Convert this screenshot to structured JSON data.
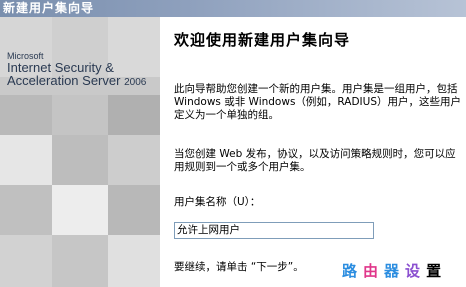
{
  "window": {
    "title": "新建用户集向导"
  },
  "banner": {
    "microsoft": "Microsoft",
    "line1": "Internet Security &",
    "line2": "Acceleration Server",
    "version": "2006"
  },
  "main": {
    "heading": "欢迎使用新建用户集向导",
    "intro": "此向导帮助您创建一个新的用户集。用户集是一组用户，包括 Windows 或非 Windows（例如，RADIUS）用户，这些用户定义为一个单独的组。",
    "usage": "当您创建 Web 发布，协议，以及访问策略规则时，您可以应用规则到一个或多个用户集。",
    "name_label": "用户集名称（U）：",
    "name_value": "允许上网用户",
    "continue_text": "要继续，请单击 “下一步”。"
  },
  "watermark": [
    "路",
    "由",
    "器",
    "设",
    "置"
  ],
  "colors": {
    "titlebar": "#8ea0bd",
    "banner_bg": "#c9c9c9",
    "brand_text": "#2a3a52",
    "watermark_blue": "#2b8de0",
    "watermark_pink": "#e0368a",
    "watermark_purple": "#8a4fd0"
  }
}
